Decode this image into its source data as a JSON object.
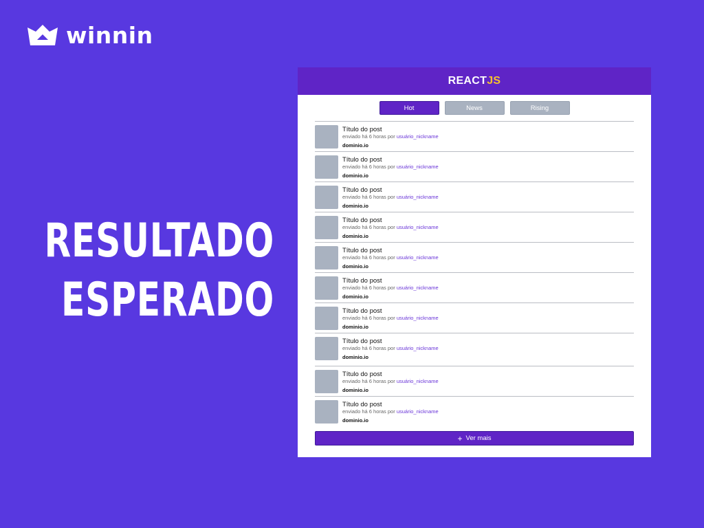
{
  "brand": {
    "name": "winnin",
    "icon": "crown-icon"
  },
  "headline": {
    "line1": "RESULTADO",
    "line2": "ESPERADO"
  },
  "app": {
    "logo_part1": "REACT",
    "logo_part2": "JS",
    "tabs": [
      {
        "label": "Hot",
        "active": true
      },
      {
        "label": "News",
        "active": false
      },
      {
        "label": "Rising",
        "active": false
      }
    ],
    "posts": [
      {
        "title": "Título do post",
        "sent": "enviado há 6 horas por",
        "user": "usuário_nickname",
        "domain": "dominio.io"
      },
      {
        "title": "Título do post",
        "sent": "enviado há 6 horas por",
        "user": "usuário_nickname",
        "domain": "dominio.io"
      },
      {
        "title": "Título do post",
        "sent": "enviado há 6 horas por",
        "user": "usuário_nickname",
        "domain": "dominio.io"
      },
      {
        "title": "Título do post",
        "sent": "enviado há 6 horas por",
        "user": "usuário_nickname",
        "domain": "dominio.io"
      },
      {
        "title": "Título do post",
        "sent": "enviado há 6 horas por",
        "user": "usuário_nickname",
        "domain": "dominio.io"
      },
      {
        "title": "Título do post",
        "sent": "enviado há 6 horas por",
        "user": "usuário_nickname",
        "domain": "dominio.io"
      },
      {
        "title": "Título do post",
        "sent": "enviado há 6 horas por",
        "user": "usuário_nickname",
        "domain": "dominio.io"
      },
      {
        "title": "Título do post",
        "sent": "enviado há 6 horas por",
        "user": "usuário_nickname",
        "domain": "dominio.io"
      },
      {
        "title": "Título do post",
        "sent": "enviado há 6 horas por",
        "user": "usuário_nickname",
        "domain": "dominio.io"
      },
      {
        "title": "Título do post",
        "sent": "enviado há 6 horas por",
        "user": "usuário_nickname",
        "domain": "dominio.io"
      }
    ],
    "more_label": "Ver mais",
    "more_icon": "plus-icon"
  },
  "colors": {
    "background": "#5838e0",
    "primary": "#5f24c6",
    "accent": "#f6c22c",
    "placeholder": "#a9b2c0"
  }
}
